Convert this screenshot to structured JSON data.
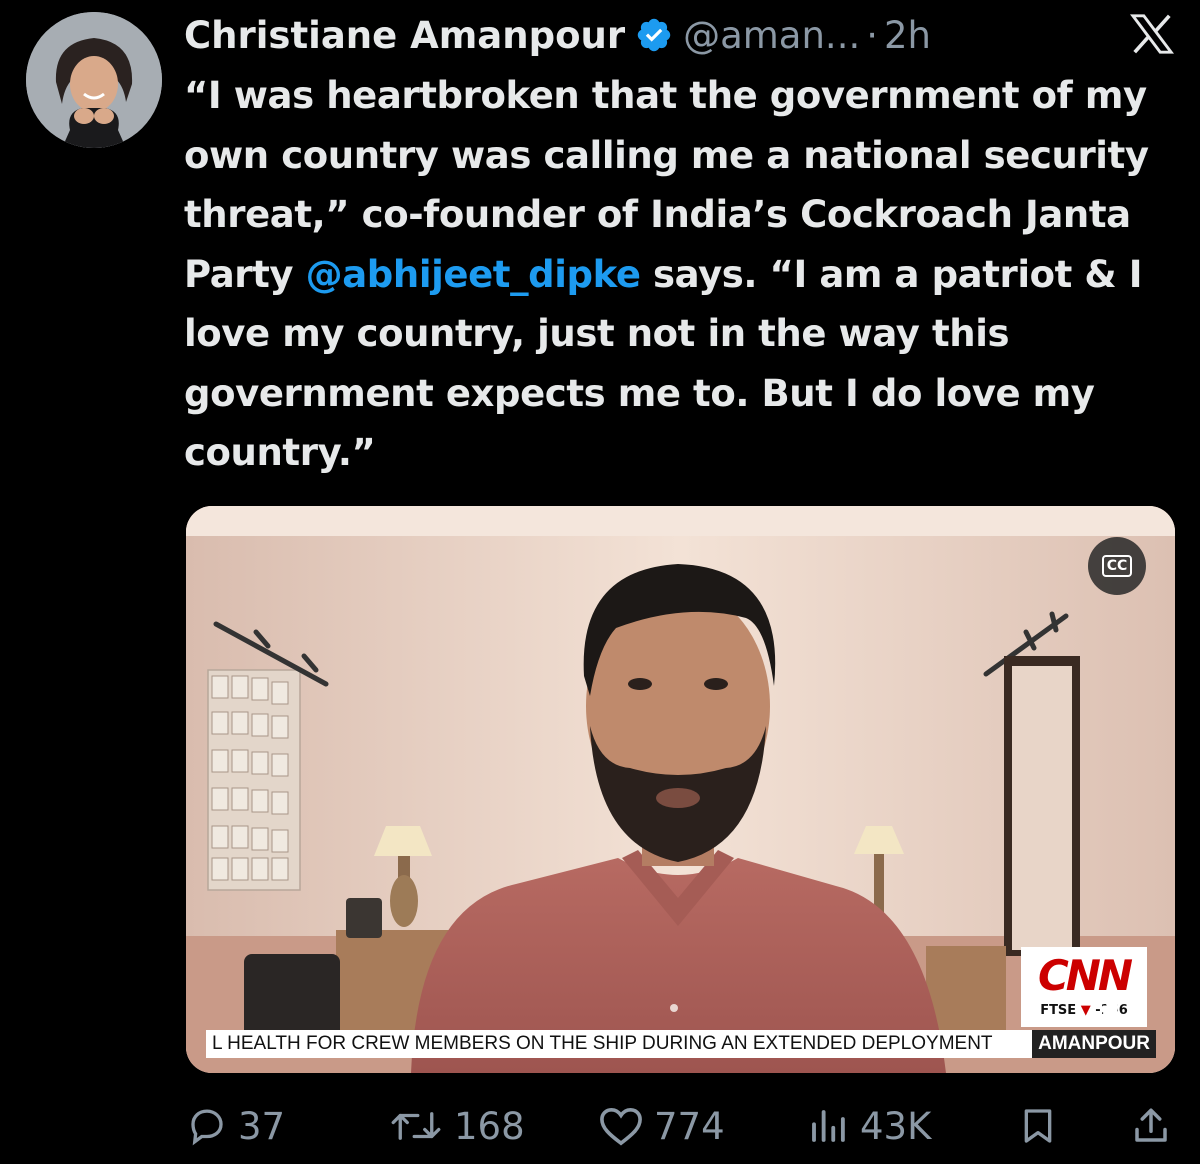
{
  "tweet": {
    "author_name": "Christiane Amanpour",
    "handle": "@aman...",
    "separator": "·",
    "time": "2h",
    "text_before_mention": "“I was heartbroken that the government of my own country was calling me a national security threat,” co-founder of India’s Cockroach Janta Party ",
    "mention": "@abhijeet_dipke",
    "text_after_mention": " says. “I am a patriot & I love my country, just not in the way this government expects me to. But I do love my country.”"
  },
  "media": {
    "cc_label": "CC",
    "network_logo": "CNN",
    "ftse_label": "FTSE",
    "ftse_arrow": "▼",
    "ftse_value": "-156",
    "ticker_text": "L HEALTH FOR CREW MEMBERS ON THE SHIP DURING AN EXTENDED DEPLOYMENT",
    "ticker_show": "AMANPOUR"
  },
  "actions": {
    "replies": "37",
    "reposts": "168",
    "likes": "774",
    "views": "43K"
  },
  "icons": {
    "verified": "verified-badge-icon",
    "x_logo": "x-logo-icon",
    "reply": "reply-icon",
    "repost": "repost-icon",
    "like": "heart-icon",
    "views": "views-icon",
    "bookmark": "bookmark-icon",
    "share": "share-icon"
  },
  "colors": {
    "background": "#000000",
    "text": "#e7e9ea",
    "secondary": "#8b98a5",
    "link": "#1d9bf0",
    "cnn_red": "#cc0000"
  }
}
